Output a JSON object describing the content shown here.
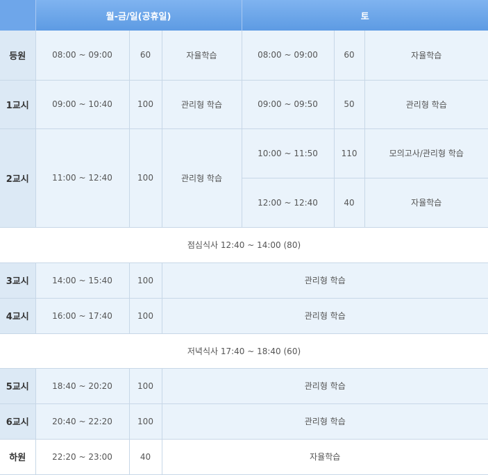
{
  "header": {
    "label": "",
    "weekday": "월-금/일(공휴일)",
    "saturday": "토"
  },
  "rows": [
    {
      "label": "등원",
      "wd_time": "08:00 ~ 09:00",
      "wd_min": "60",
      "wd_act": "자율학습",
      "sat_time": "08:00 ~ 09:00",
      "sat_min": "60",
      "sat_act": "자율학습"
    },
    {
      "label": "1교시",
      "wd_time": "09:00 ~ 10:40",
      "wd_min": "100",
      "wd_act": "관리형 학습",
      "sat_time": "09:00 ~ 09:50",
      "sat_min": "50",
      "sat_act": "관리형 학습"
    },
    {
      "label": "2교시",
      "wd_time": "11:00 ~ 12:40",
      "wd_min": "100",
      "wd_act": "관리형 학습",
      "sat": [
        {
          "time": "10:00 ~ 11:50",
          "min": "110",
          "act": "모의고사/관리형 학습"
        },
        {
          "time": "12:00 ~ 12:40",
          "min": "40",
          "act": "자율학습"
        }
      ]
    },
    {
      "lunch": "점심식사 12:40 ~ 14:00 (80)"
    },
    {
      "label": "3교시",
      "time": "14:00 ~ 15:40",
      "min": "100",
      "act": "관리형 학습"
    },
    {
      "label": "4교시",
      "time": "16:00 ~ 17:40",
      "min": "100",
      "act": "관리형 학습"
    },
    {
      "dinner": "저녁식사 17:40 ~ 18:40 (60)"
    },
    {
      "label": "5교시",
      "time": "18:40 ~ 20:20",
      "min": "100",
      "act": "관리형 학습"
    },
    {
      "label": "6교시",
      "time": "20:40 ~ 22:20",
      "min": "100",
      "act": "관리형 학습"
    },
    {
      "label": "하원",
      "time": "22:20 ~ 23:00",
      "min": "40",
      "act": "자율학습"
    }
  ],
  "colors": {
    "header": "#6ea6ea",
    "row_shade": "#eaf3fb",
    "label_shade": "#dce9f5",
    "border": "#c7d7e7"
  }
}
